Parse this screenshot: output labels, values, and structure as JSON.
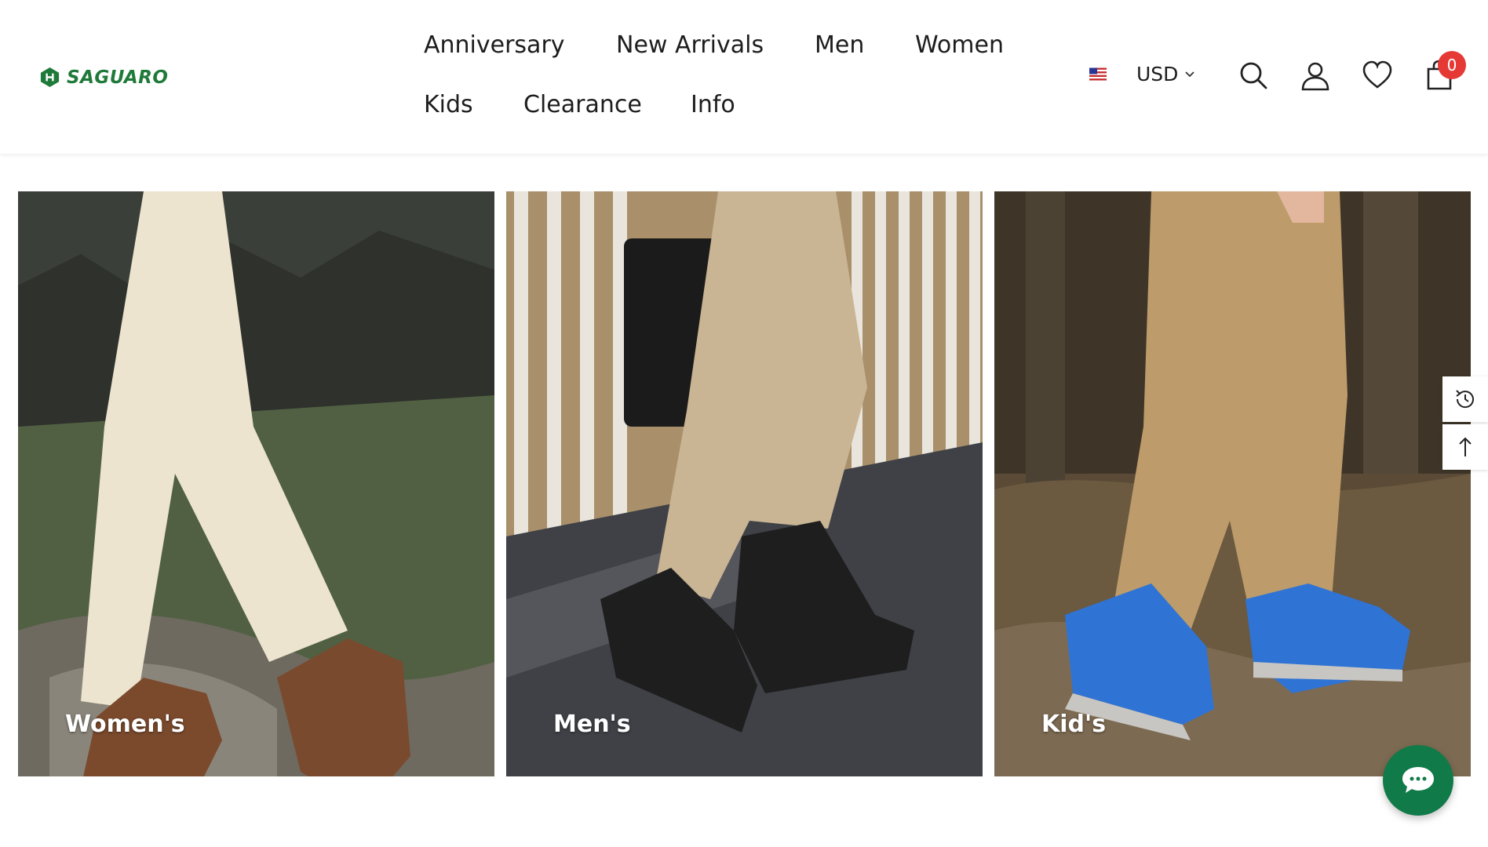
{
  "brand": {
    "name": "SAGUARO",
    "logo_icon": "saguaro-logo-icon",
    "color": "#1f7a3a"
  },
  "nav": {
    "items": [
      {
        "label": "Anniversary"
      },
      {
        "label": "New Arrivals"
      },
      {
        "label": "Men"
      },
      {
        "label": "Women"
      },
      {
        "label": "Kids"
      },
      {
        "label": "Clearance"
      },
      {
        "label": "Info"
      }
    ]
  },
  "utility": {
    "flag_icon": "us-flag-icon",
    "currency": "USD",
    "search_icon": "search-icon",
    "account_icon": "user-icon",
    "wishlist_icon": "heart-icon",
    "cart_icon": "cart-icon",
    "cart_count": "0",
    "badge_color": "#e53935"
  },
  "categories": [
    {
      "label": "Women's"
    },
    {
      "label": "Men's"
    },
    {
      "label": "Kid's"
    }
  ],
  "side_tools": {
    "recent_icon": "history-icon",
    "top_icon": "arrow-up-icon"
  },
  "chat": {
    "icon": "chat-bubble-icon",
    "color": "#107a48"
  }
}
